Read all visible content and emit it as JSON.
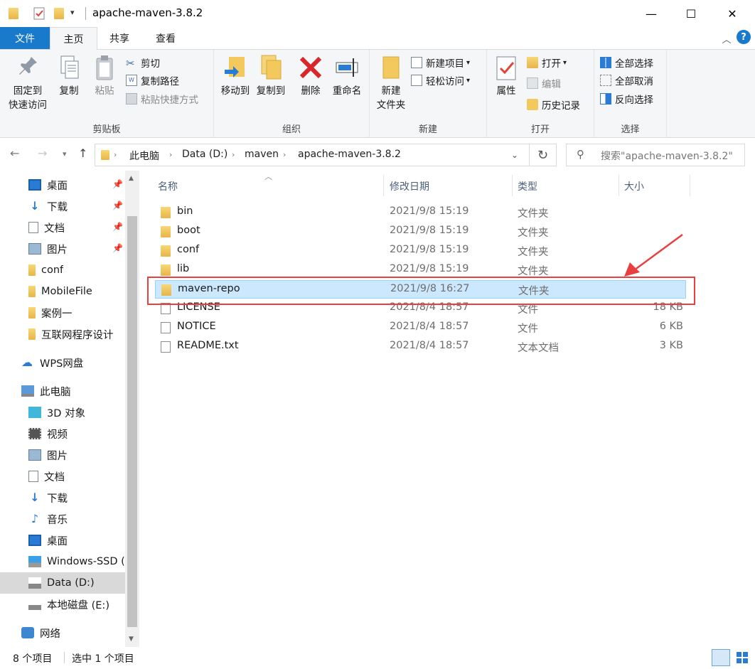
{
  "window": {
    "title": "apache-maven-3.8.2",
    "minimize": "—",
    "maximize": "☐",
    "close": "✕"
  },
  "ribbon_tabs": {
    "file": "文件",
    "home": "主页",
    "share": "共享",
    "view": "查看"
  },
  "clipboard": {
    "pin_line1": "固定到",
    "pin_line2": "快速访问",
    "copy": "复制",
    "paste": "粘贴",
    "cut": "剪切",
    "copy_path": "复制路径",
    "paste_shortcut": "粘贴快捷方式",
    "group": "剪贴板"
  },
  "organize": {
    "move_to": "移动到",
    "copy_to": "复制到",
    "delete": "删除",
    "rename": "重命名",
    "group": "组织"
  },
  "new": {
    "new_folder_line1": "新建",
    "new_folder_line2": "文件夹",
    "new_item": "新建项目",
    "easy_access": "轻松访问",
    "group": "新建"
  },
  "open": {
    "properties": "属性",
    "open": "打开",
    "edit": "编辑",
    "history": "历史记录",
    "group": "打开"
  },
  "select": {
    "select_all": "全部选择",
    "select_none": "全部取消",
    "invert": "反向选择",
    "group": "选择"
  },
  "address": {
    "crumbs": [
      "此电脑",
      "Data (D:)",
      "maven",
      "apache-maven-3.8.2"
    ],
    "search_placeholder": "搜索\"apache-maven-3.8.2\""
  },
  "nav_pane": {
    "quick": [
      "桌面",
      "下载",
      "文档",
      "图片",
      "conf",
      "MobileFile",
      "案例一",
      "互联网程序设计"
    ],
    "wps": "WPS网盘",
    "this_pc": "此电脑",
    "pc_items": [
      "3D 对象",
      "视频",
      "图片",
      "文档",
      "下载",
      "音乐",
      "桌面",
      "Windows-SSD (",
      "Data (D:)",
      "本地磁盘 (E:)"
    ],
    "network": "网络"
  },
  "columns": {
    "name": "名称",
    "date": "修改日期",
    "type": "类型",
    "size": "大小"
  },
  "files": [
    {
      "name": "bin",
      "date": "2021/9/8 15:19",
      "type": "文件夹",
      "size": ""
    },
    {
      "name": "boot",
      "date": "2021/9/8 15:19",
      "type": "文件夹",
      "size": ""
    },
    {
      "name": "conf",
      "date": "2021/9/8 15:19",
      "type": "文件夹",
      "size": ""
    },
    {
      "name": "lib",
      "date": "2021/9/8 15:19",
      "type": "文件夹",
      "size": ""
    },
    {
      "name": "maven-repo",
      "date": "2021/9/8 16:27",
      "type": "文件夹",
      "size": "",
      "selected": true
    },
    {
      "name": "LICENSE",
      "date": "2021/8/4 18:57",
      "type": "文件",
      "size": "18 KB"
    },
    {
      "name": "NOTICE",
      "date": "2021/8/4 18:57",
      "type": "文件",
      "size": "6 KB"
    },
    {
      "name": "README.txt",
      "date": "2021/8/4 18:57",
      "type": "文本文档",
      "size": "3 KB"
    }
  ],
  "status": {
    "count": "8 个项目",
    "selected": "选中 1 个项目"
  },
  "colors": {
    "accent": "#1979ca",
    "selection": "#cce8ff",
    "annotation": "#e84040"
  }
}
